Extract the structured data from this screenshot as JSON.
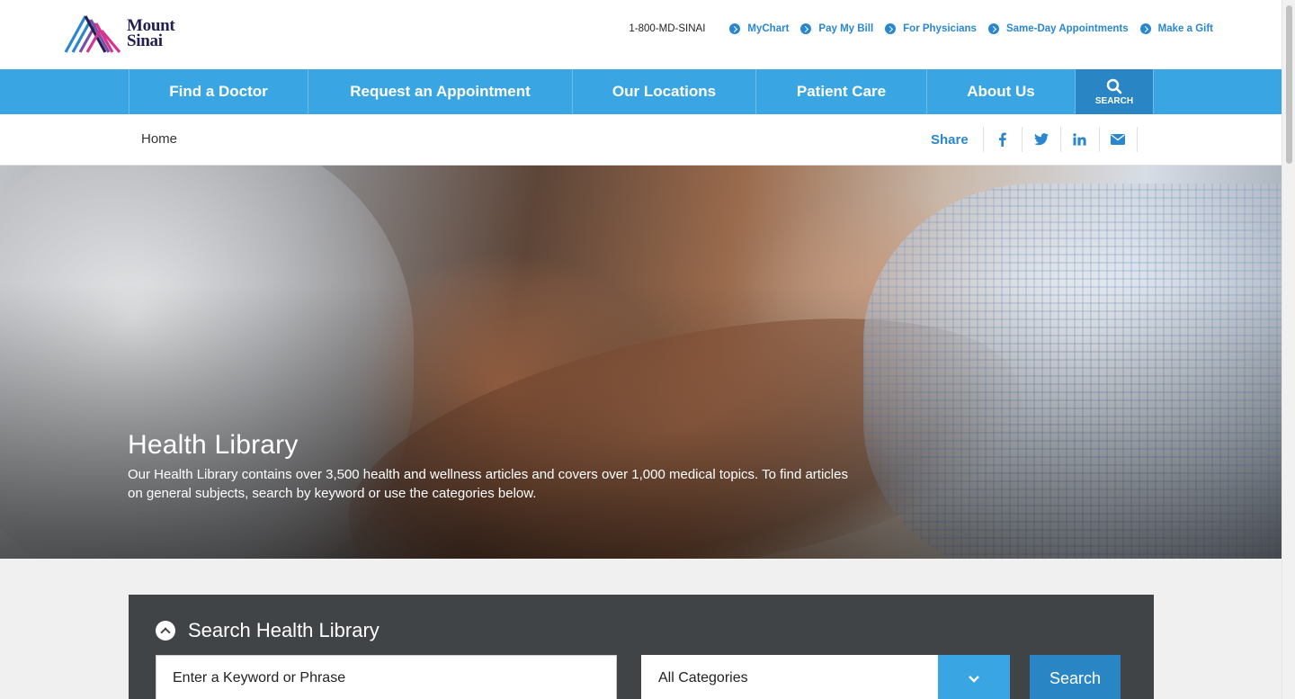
{
  "header": {
    "logo_line1": "Mount",
    "logo_line2": "Sinai",
    "phone": "1-800-MD-SINAI",
    "utility_links": [
      "MyChart",
      "Pay My Bill",
      "For Physicians",
      "Same-Day Appointments",
      "Make a Gift"
    ]
  },
  "nav": {
    "items": [
      "Find a Doctor",
      "Request an Appointment",
      "Our Locations",
      "Patient Care",
      "About Us"
    ],
    "search_label": "SEARCH"
  },
  "breadcrumb": {
    "home": "Home"
  },
  "share": {
    "label": "Share",
    "icons": [
      "facebook-icon",
      "twitter-icon",
      "linkedin-icon",
      "email-icon"
    ]
  },
  "hero": {
    "title": "Health Library",
    "description": "Our Health Library contains over 3,500 health and wellness articles and covers over 1,000 medical topics. To find articles on general subjects, search by keyword or use the categories below."
  },
  "search_panel": {
    "title": "Search Health Library",
    "keyword_placeholder": "Enter a Keyword or Phrase",
    "category_value": "All Categories",
    "button_label": "Search"
  },
  "colors": {
    "nav_blue": "#3aa5e3",
    "link_blue": "#2a87cf",
    "search_dark_blue": "#2a85c4",
    "panel_gray": "#414447"
  }
}
